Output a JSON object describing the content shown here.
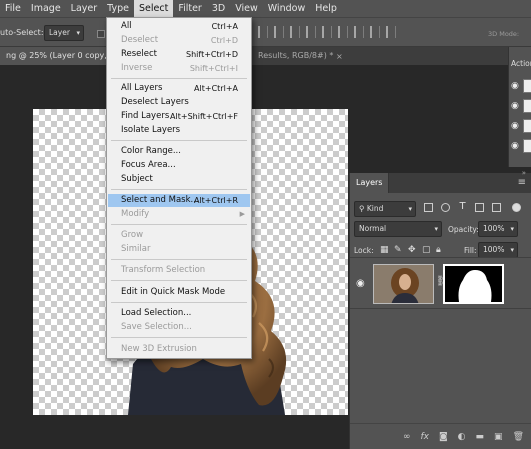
{
  "menubar": {
    "items": [
      "File",
      "Image",
      "Layer",
      "Type",
      "Select",
      "Filter",
      "3D",
      "View",
      "Window",
      "Help"
    ],
    "active": "Select"
  },
  "options": {
    "auto_select_label": "uto-Select:",
    "auto_select_value": "Layer",
    "mode3d": "3D Mode:"
  },
  "doc_tabs": {
    "active": "ng @ 25% (Layer 0 copy, Laye",
    "other": "Results, RGB/8#) *",
    "close": "×"
  },
  "select_menu": [
    {
      "label": "All",
      "shortcut": "Ctrl+A",
      "enabled": true
    },
    {
      "label": "Deselect",
      "shortcut": "Ctrl+D",
      "enabled": false
    },
    {
      "label": "Reselect",
      "shortcut": "Shift+Ctrl+D",
      "enabled": true
    },
    {
      "label": "Inverse",
      "shortcut": "Shift+Ctrl+I",
      "enabled": false
    },
    {
      "label": "All Layers",
      "shortcut": "Alt+Ctrl+A",
      "enabled": true
    },
    {
      "label": "Deselect Layers",
      "shortcut": "",
      "enabled": true
    },
    {
      "label": "Find Layers",
      "shortcut": "Alt+Shift+Ctrl+F",
      "enabled": true
    },
    {
      "label": "Isolate Layers",
      "shortcut": "",
      "enabled": true
    },
    {
      "label": "Color Range...",
      "shortcut": "",
      "enabled": true
    },
    {
      "label": "Focus Area...",
      "shortcut": "",
      "enabled": true
    },
    {
      "label": "Subject",
      "shortcut": "",
      "enabled": true
    },
    {
      "label": "Select and Mask...",
      "shortcut": "Alt+Ctrl+R",
      "enabled": true,
      "highlighted": true
    },
    {
      "label": "Modify",
      "shortcut": "",
      "enabled": false,
      "submenu": true
    },
    {
      "label": "Grow",
      "shortcut": "",
      "enabled": false
    },
    {
      "label": "Similar",
      "shortcut": "",
      "enabled": false
    },
    {
      "label": "Transform Selection",
      "shortcut": "",
      "enabled": false
    },
    {
      "label": "Edit in Quick Mask Mode",
      "shortcut": "",
      "enabled": true
    },
    {
      "label": "Load Selection...",
      "shortcut": "",
      "enabled": true
    },
    {
      "label": "Save Selection...",
      "shortcut": "",
      "enabled": false
    },
    {
      "label": "New 3D Extrusion",
      "shortcut": "",
      "enabled": false
    }
  ],
  "actions_panel": {
    "title": "Action"
  },
  "layers_panel": {
    "title": "Layers",
    "filter_kind": "Kind",
    "blend_mode": "Normal",
    "opacity_label": "Opacity:",
    "opacity": "100%",
    "lock_label": "Lock:",
    "fill_label": "Fill:",
    "fill": "100%",
    "footer_icons": [
      "link-icon",
      "fx-icon",
      "mask-icon",
      "adjustment-icon",
      "folder-icon",
      "new-layer-icon",
      "trash-icon"
    ],
    "footer_fx": "fx"
  },
  "colors": {
    "menu_bg": "#535353",
    "canvas_bg": "#282828",
    "highlight": "#9fc7f0",
    "dropdown_bg": "#f0f0f0"
  }
}
